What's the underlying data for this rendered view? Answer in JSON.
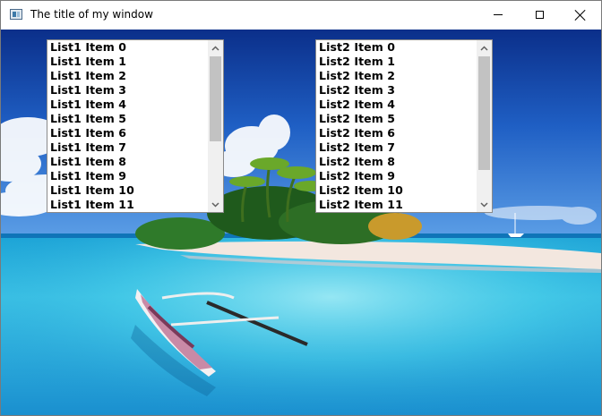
{
  "window": {
    "title": "The title of my window",
    "icon": "app-window-icon",
    "controls": [
      "minimize-icon",
      "maximize-icon",
      "close-icon"
    ]
  },
  "list1": {
    "items": [
      "List1 Item 0",
      "List1 Item 1",
      "List1 Item 2",
      "List1 Item 3",
      "List1 Item 4",
      "List1 Item 5",
      "List1 Item 6",
      "List1 Item 7",
      "List1 Item 8",
      "List1 Item 9",
      "List1 Item 10",
      "List1 Item 11"
    ],
    "scroll_position": 0
  },
  "list2": {
    "items": [
      "List2 Item 0",
      "List2 Item 1",
      "List2 Item 2",
      "List2 Item 3",
      "List2 Item 4",
      "List2 Item 5",
      "List2 Item 6",
      "List2 Item 7",
      "List2 Item 8",
      "List2 Item 9",
      "List2 Item 10",
      "List2 Item 11"
    ],
    "scroll_position": 0
  },
  "background": {
    "description_icon": "tropical-beach-photo"
  }
}
